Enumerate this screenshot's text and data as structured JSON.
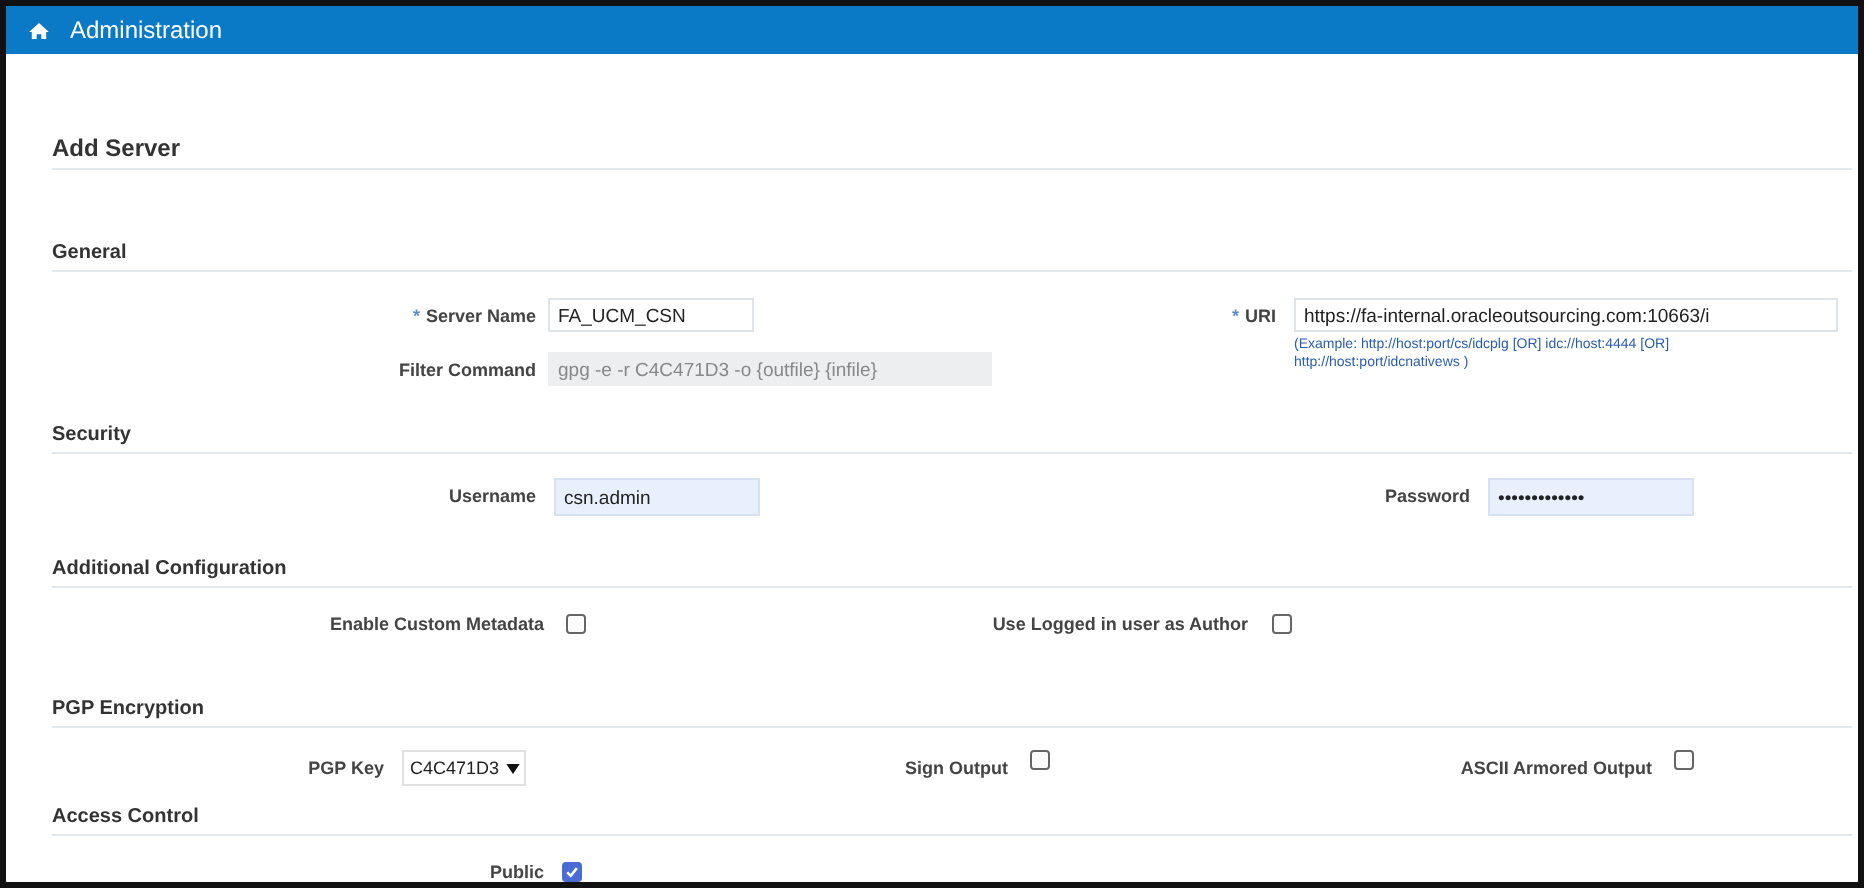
{
  "header": {
    "title": "Administration"
  },
  "page_title": "Add Server",
  "sections": [
    {
      "title": "General",
      "rows": [
        {
          "fields": [
            {
              "kind": "text",
              "marker": "*",
              "label": "Server Name",
              "value": "FA_UCM_CSN",
              "disabled": false,
              "autofilled": false
            },
            {
              "kind": "text",
              "marker": "*",
              "label": "URI",
              "value": "https://fa-internal.oracleoutsourcing.com:10663/i",
              "hint": "(Example: http://host:port/cs/idcplg [OR] idc://host:4444 [OR] http://host:port/idcnativews )",
              "disabled": false,
              "autofilled": false
            }
          ]
        },
        {
          "fields": [
            {
              "kind": "text",
              "label": "Filter Command",
              "value": "gpg -e -r C4C471D3 -o {outfile} {infile}",
              "disabled": true,
              "autofilled": false
            }
          ]
        }
      ]
    },
    {
      "title": "Security",
      "rows": [
        {
          "fields": [
            {
              "kind": "text",
              "label": "Username",
              "value": "csn.admin",
              "disabled": false,
              "autofilled": true
            },
            {
              "kind": "text",
              "label": "Password",
              "value": "•••••••••••••",
              "disabled": false,
              "autofilled": true
            }
          ]
        }
      ]
    },
    {
      "title": "Additional Configuration",
      "rows": [
        {
          "fields": [
            {
              "kind": "checkbox",
              "label": "Enable Custom Metadata",
              "checked": false
            },
            {
              "kind": "checkbox",
              "label": "Use Logged in user as Author",
              "checked": false
            }
          ]
        }
      ]
    },
    {
      "title": "PGP Encryption",
      "rows": [
        {
          "fields": [
            {
              "kind": "select",
              "label": "PGP Key",
              "value": "C4C471D3"
            },
            {
              "kind": "checkbox",
              "label": "Sign Output",
              "checked": false
            },
            {
              "kind": "checkbox",
              "label": "ASCII Armored Output",
              "checked": false
            }
          ]
        }
      ]
    },
    {
      "title": "Access Control",
      "rows": [
        {
          "fields": [
            {
              "kind": "checkbox",
              "label": "Public",
              "checked": true
            }
          ]
        }
      ]
    }
  ]
}
